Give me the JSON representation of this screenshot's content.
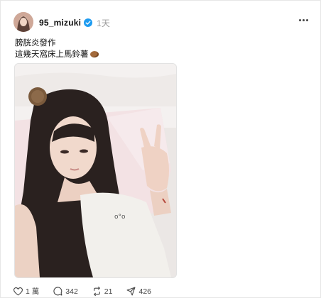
{
  "post": {
    "username": "95_mizuki",
    "time": "1天",
    "text_line1": "膀胱炎發作",
    "text_line2": "這幾天窩床上馬鈴薯"
  },
  "actions": {
    "likes": "1 萬",
    "comments": "342",
    "reposts": "21",
    "shares": "426"
  },
  "icons": [
    "verified-icon",
    "more-icon",
    "heart-icon",
    "comment-icon",
    "repost-icon",
    "share-icon",
    "potato-emoji"
  ],
  "colors": {
    "verified": "#1d9bf0",
    "muted": "#9a9a9a"
  }
}
